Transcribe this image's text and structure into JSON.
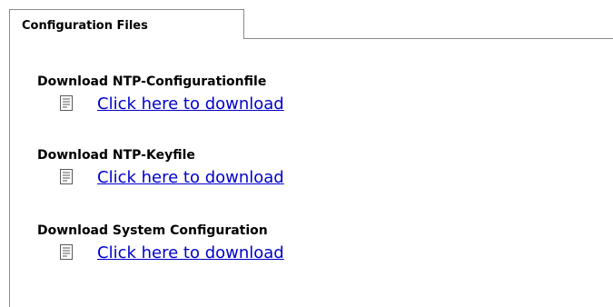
{
  "panel": {
    "tab_label": "Configuration Files"
  },
  "sections": [
    {
      "heading": "Download NTP-Configurationfile",
      "link_label": "Click here to download",
      "icon": "document-icon"
    },
    {
      "heading": "Download NTP-Keyfile",
      "link_label": "Click here to download",
      "icon": "document-icon"
    },
    {
      "heading": "Download System Configuration",
      "link_label": "Click here to download",
      "icon": "document-icon"
    }
  ],
  "colors": {
    "link": "#0000cc",
    "border": "#8a8a8a"
  }
}
